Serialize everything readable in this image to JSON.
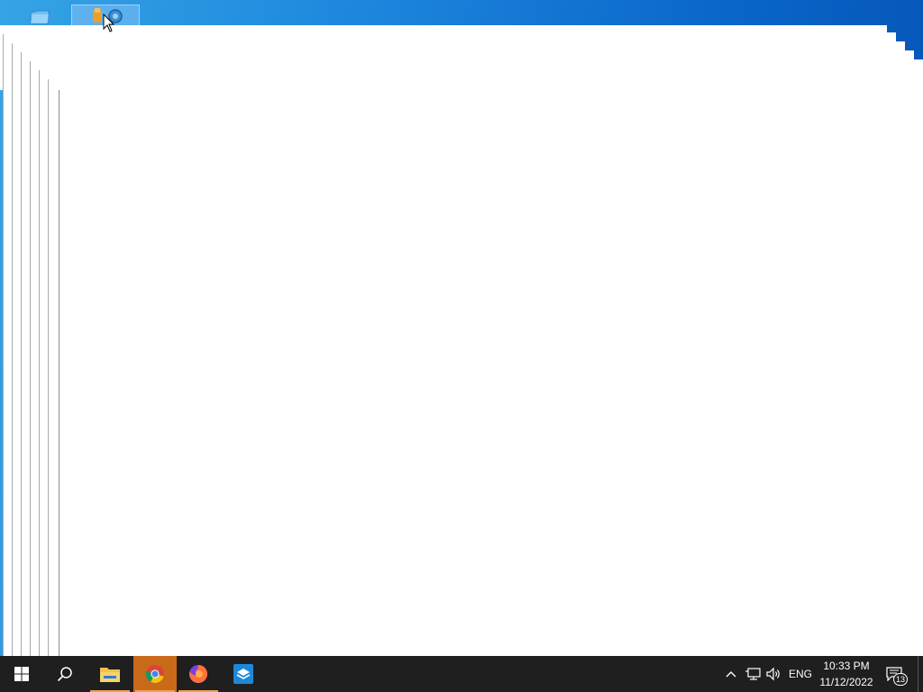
{
  "desktop": {
    "icons": [
      {
        "name": "folder-shortcut",
        "label": ""
      },
      {
        "name": "app-shortcut-selected",
        "label": ""
      }
    ]
  },
  "windows": {
    "count": 7,
    "content": ""
  },
  "taskbar": {
    "start_label": "Start",
    "search_label": "Search",
    "pinned": [
      {
        "name": "File Explorer",
        "icon": "folder-icon"
      },
      {
        "name": "Google Chrome",
        "icon": "chrome-icon",
        "active": true
      },
      {
        "name": "Firefox",
        "icon": "firefox-icon"
      },
      {
        "name": "App",
        "icon": "box-app-icon"
      }
    ],
    "tray": {
      "language": "ENG",
      "time": "10:33 PM",
      "date": "11/12/2022",
      "notification_count": "13"
    }
  },
  "colors": {
    "taskbar_bg": "#1f1f1f",
    "active_app": "#c96a1a",
    "wallpaper": "#0a66c9"
  }
}
